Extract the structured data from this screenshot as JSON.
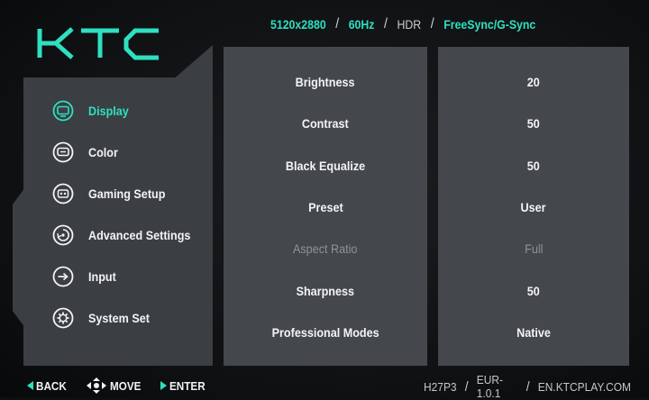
{
  "brand": {
    "logo_text": "KTC",
    "accent_color": "#2ee0c0"
  },
  "header": {
    "resolution": "5120x2880",
    "refresh_rate": "60Hz",
    "hdr": "HDR",
    "sync": "FreeSync/G-Sync",
    "separator": "/"
  },
  "sidebar": {
    "items": [
      {
        "label": "Display",
        "icon": "display-icon",
        "active": true
      },
      {
        "label": "Color",
        "icon": "color-icon",
        "active": false
      },
      {
        "label": "Gaming Setup",
        "icon": "gaming-setup-icon",
        "active": false
      },
      {
        "label": "Advanced Settings",
        "icon": "advanced-settings-icon",
        "active": false
      },
      {
        "label": "Input",
        "icon": "input-icon",
        "active": false
      },
      {
        "label": "System Set",
        "icon": "system-set-icon",
        "active": false
      }
    ]
  },
  "settings": [
    {
      "label": "Brightness",
      "value": "20",
      "enabled": true
    },
    {
      "label": "Contrast",
      "value": "50",
      "enabled": true
    },
    {
      "label": "Black Equalize",
      "value": "50",
      "enabled": true
    },
    {
      "label": "Preset",
      "value": "User",
      "enabled": true
    },
    {
      "label": "Aspect Ratio",
      "value": "Full",
      "enabled": false
    },
    {
      "label": "Sharpness",
      "value": "50",
      "enabled": true
    },
    {
      "label": "Professional Modes",
      "value": "Native",
      "enabled": true
    }
  ],
  "footer": {
    "back": "BACK",
    "move": "MOVE",
    "enter": "ENTER",
    "model": "H27P3",
    "firmware": "EUR-1.0.1",
    "website": "EN.KTCPLAY.COM",
    "separator": "/"
  }
}
